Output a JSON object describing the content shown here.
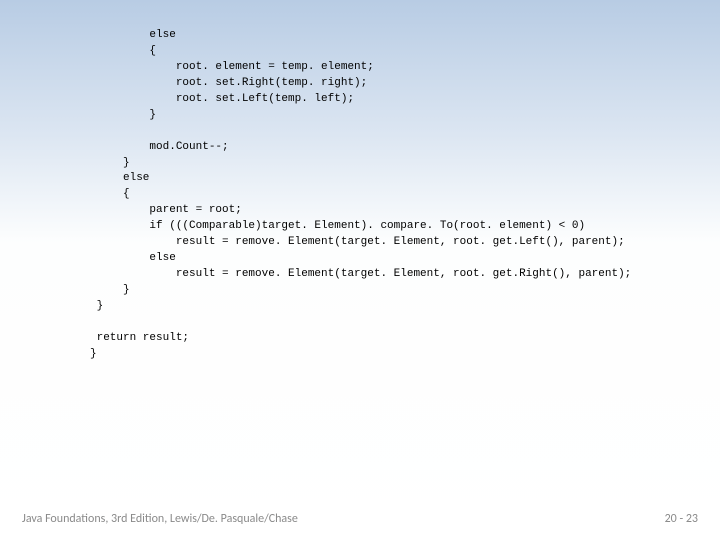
{
  "code": {
    "l01": "         else",
    "l02": "         {",
    "l03": "             root. element = temp. element;",
    "l04": "             root. set.Right(temp. right);",
    "l05": "             root. set.Left(temp. left);",
    "l06": "         }",
    "l07": "",
    "l08": "         mod.Count--;",
    "l09": "     }",
    "l10": "     else",
    "l11": "     {",
    "l12": "         parent = root;",
    "l13": "         if (((Comparable)target. Element). compare. To(root. element) < 0)",
    "l14": "             result = remove. Element(target. Element, root. get.Left(), parent);",
    "l15": "         else",
    "l16": "             result = remove. Element(target. Element, root. get.Right(), parent);",
    "l17": "     }",
    "l18": " }",
    "l19": "",
    "l20": " return result;",
    "l21": "}"
  },
  "footer": {
    "left": "Java Foundations, 3rd Edition, Lewis/De. Pasquale/Chase",
    "right": "20 - 23"
  }
}
